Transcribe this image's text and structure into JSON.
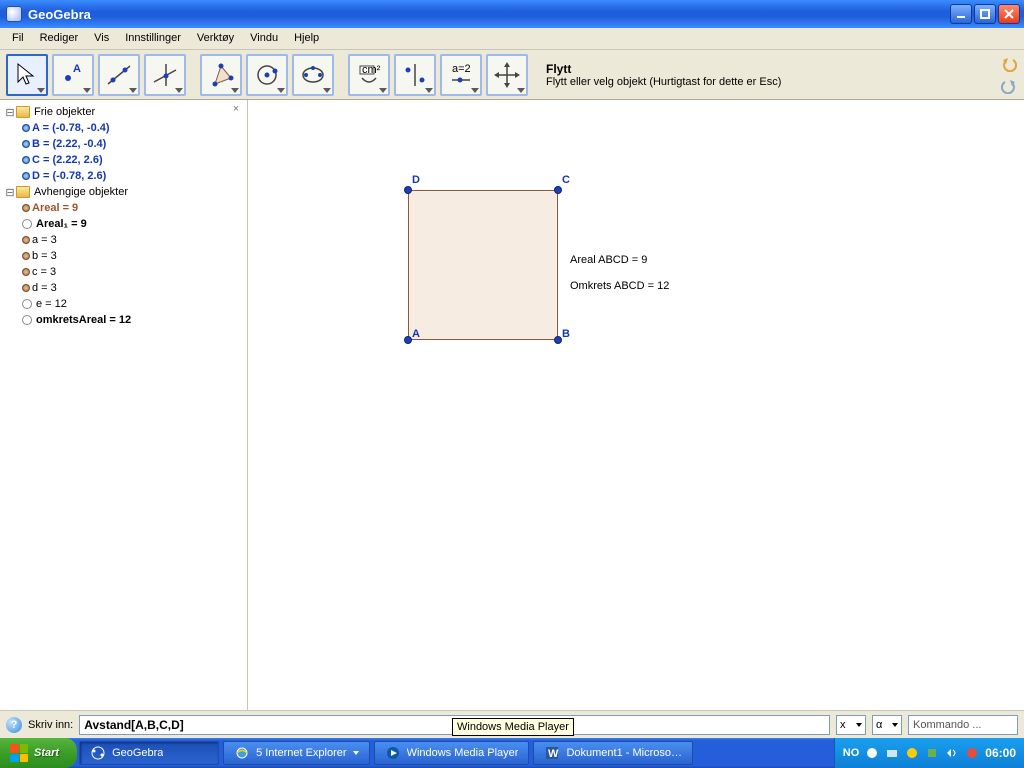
{
  "window": {
    "title": "GeoGebra"
  },
  "menu": [
    "Fil",
    "Rediger",
    "Vis",
    "Innstillinger",
    "Verktøy",
    "Vindu",
    "Hjelp"
  ],
  "tool_desc": {
    "title": "Flytt",
    "subtitle": "Flytt eller velg objekt (Hurtigtast for dette er Esc)"
  },
  "sidebar": {
    "free_label": "Frie objekter",
    "dep_label": "Avhengige objekter",
    "points": [
      {
        "text": "A = (-0.78, -0.4)"
      },
      {
        "text": "B = (2.22, -0.4)"
      },
      {
        "text": "C = (2.22, 2.6)"
      },
      {
        "text": "D = (-0.78, 2.6)"
      }
    ],
    "deps": [
      {
        "text": "Areal = 9",
        "cls": "areal",
        "icon": "dot-brown"
      },
      {
        "text": "Areal₁ = 9",
        "cls": "bold",
        "icon": "radio"
      },
      {
        "text": "a = 3",
        "cls": "dep",
        "icon": "dot-brown"
      },
      {
        "text": "b = 3",
        "cls": "dep",
        "icon": "dot-brown"
      },
      {
        "text": "c = 3",
        "cls": "dep",
        "icon": "dot-brown"
      },
      {
        "text": "d = 3",
        "cls": "dep",
        "icon": "dot-brown"
      },
      {
        "text": "e = 12",
        "cls": "dep",
        "icon": "radio"
      },
      {
        "text": "omkretsAreal = 12",
        "cls": "bold",
        "icon": "radio"
      }
    ]
  },
  "canvas": {
    "labels": {
      "a": "A",
      "b": "B",
      "c": "C",
      "d": "D"
    },
    "text1": "Areal ABCD = 9",
    "text2": "Omkrets ABCD = 12"
  },
  "inputbar": {
    "label": "Skriv inn:",
    "value": "Avstand[A,B,C,D]",
    "mini1": "x",
    "mini2": "α",
    "kommando": "Kommando ..."
  },
  "tooltip": "Windows Media Player",
  "taskbar": {
    "start": "Start",
    "items": [
      {
        "label": "GeoGebra",
        "icon": "geo"
      },
      {
        "label": "5 Internet Explorer",
        "icon": "ie",
        "dd": true
      },
      {
        "label": "Windows Media Player",
        "icon": "wmp"
      },
      {
        "label": "Dokument1 - Microsof...",
        "icon": "word"
      }
    ],
    "lang": "NO",
    "clock": "06:00"
  }
}
